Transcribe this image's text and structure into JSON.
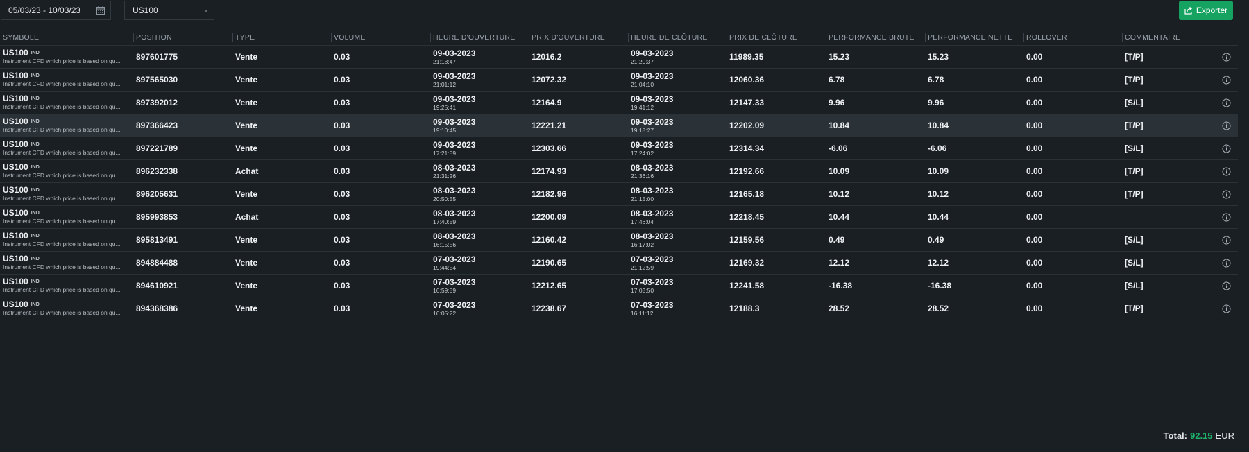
{
  "toolbar": {
    "date_range": "05/03/23 - 10/03/23",
    "symbol_filter": "US100",
    "export_label": "Exporter"
  },
  "columns": [
    "SYMBOLE",
    "POSITION",
    "TYPE",
    "VOLUME",
    "HEURE D'OUVERTURE",
    "PRIX D'OUVERTURE",
    "HEURE DE CLÔTURE",
    "PRIX DE CLÔTURE",
    "PERFORMANCE BRUTE",
    "PERFORMANCE NETTE",
    "ROLLOVER",
    "COMMENTAIRE"
  ],
  "rows": [
    {
      "symbol": "US100",
      "tag": "IND",
      "desc": "Instrument CFD which price is based on qu...",
      "position": "897601775",
      "type": "Vente",
      "volume": "0.03",
      "open_date": "09-03-2023",
      "open_time": "21:18:47",
      "open_price": "12016.2",
      "close_date": "09-03-2023",
      "close_time": "21:20:37",
      "close_price": "11989.35",
      "gross": "15.23",
      "net": "15.23",
      "net_sign": "pos",
      "rollover": "0.00",
      "comment": "[T/P]"
    },
    {
      "symbol": "US100",
      "tag": "IND",
      "desc": "Instrument CFD which price is based on qu...",
      "position": "897565030",
      "type": "Vente",
      "volume": "0.03",
      "open_date": "09-03-2023",
      "open_time": "21:01:12",
      "open_price": "12072.32",
      "close_date": "09-03-2023",
      "close_time": "21:04:10",
      "close_price": "12060.36",
      "gross": "6.78",
      "net": "6.78",
      "net_sign": "pos",
      "rollover": "0.00",
      "comment": "[T/P]"
    },
    {
      "symbol": "US100",
      "tag": "IND",
      "desc": "Instrument CFD which price is based on qu...",
      "position": "897392012",
      "type": "Vente",
      "volume": "0.03",
      "open_date": "09-03-2023",
      "open_time": "19:25:41",
      "open_price": "12164.9",
      "close_date": "09-03-2023",
      "close_time": "19:41:12",
      "close_price": "12147.33",
      "gross": "9.96",
      "net": "9.96",
      "net_sign": "pos",
      "rollover": "0.00",
      "comment": "[S/L]"
    },
    {
      "symbol": "US100",
      "tag": "IND",
      "desc": "Instrument CFD which price is based on qu...",
      "position": "897366423",
      "type": "Vente",
      "volume": "0.03",
      "open_date": "09-03-2023",
      "open_time": "19:10:45",
      "open_price": "12221.21",
      "close_date": "09-03-2023",
      "close_time": "19:18:27",
      "close_price": "12202.09",
      "gross": "10.84",
      "net": "10.84",
      "net_sign": "pos",
      "rollover": "0.00",
      "comment": "[T/P]",
      "highlight": true
    },
    {
      "symbol": "US100",
      "tag": "IND",
      "desc": "Instrument CFD which price is based on qu...",
      "position": "897221789",
      "type": "Vente",
      "volume": "0.03",
      "open_date": "09-03-2023",
      "open_time": "17:21:59",
      "open_price": "12303.66",
      "close_date": "09-03-2023",
      "close_time": "17:24:02",
      "close_price": "12314.34",
      "gross": "-6.06",
      "net": "-6.06",
      "net_sign": "neg",
      "rollover": "0.00",
      "comment": "[S/L]"
    },
    {
      "symbol": "US100",
      "tag": "IND",
      "desc": "Instrument CFD which price is based on qu...",
      "position": "896232338",
      "type": "Achat",
      "volume": "0.03",
      "open_date": "08-03-2023",
      "open_time": "21:31:26",
      "open_price": "12174.93",
      "close_date": "08-03-2023",
      "close_time": "21:36:16",
      "close_price": "12192.66",
      "gross": "10.09",
      "net": "10.09",
      "net_sign": "pos",
      "rollover": "0.00",
      "comment": "[T/P]"
    },
    {
      "symbol": "US100",
      "tag": "IND",
      "desc": "Instrument CFD which price is based on qu...",
      "position": "896205631",
      "type": "Vente",
      "volume": "0.03",
      "open_date": "08-03-2023",
      "open_time": "20:50:55",
      "open_price": "12182.96",
      "close_date": "08-03-2023",
      "close_time": "21:15:00",
      "close_price": "12165.18",
      "gross": "10.12",
      "net": "10.12",
      "net_sign": "pos",
      "rollover": "0.00",
      "comment": "[T/P]"
    },
    {
      "symbol": "US100",
      "tag": "IND",
      "desc": "Instrument CFD which price is based on qu...",
      "position": "895993853",
      "type": "Achat",
      "volume": "0.03",
      "open_date": "08-03-2023",
      "open_time": "17:40:59",
      "open_price": "12200.09",
      "close_date": "08-03-2023",
      "close_time": "17:46:04",
      "close_price": "12218.45",
      "gross": "10.44",
      "net": "10.44",
      "net_sign": "pos",
      "rollover": "0.00",
      "comment": ""
    },
    {
      "symbol": "US100",
      "tag": "IND",
      "desc": "Instrument CFD which price is based on qu...",
      "position": "895813491",
      "type": "Vente",
      "volume": "0.03",
      "open_date": "08-03-2023",
      "open_time": "16:15:56",
      "open_price": "12160.42",
      "close_date": "08-03-2023",
      "close_time": "16:17:02",
      "close_price": "12159.56",
      "gross": "0.49",
      "net": "0.49",
      "net_sign": "pos",
      "rollover": "0.00",
      "comment": "[S/L]"
    },
    {
      "symbol": "US100",
      "tag": "IND",
      "desc": "Instrument CFD which price is based on qu...",
      "position": "894884488",
      "type": "Vente",
      "volume": "0.03",
      "open_date": "07-03-2023",
      "open_time": "19:44:54",
      "open_price": "12190.65",
      "close_date": "07-03-2023",
      "close_time": "21:12:59",
      "close_price": "12169.32",
      "gross": "12.12",
      "net": "12.12",
      "net_sign": "pos",
      "rollover": "0.00",
      "comment": "[S/L]"
    },
    {
      "symbol": "US100",
      "tag": "IND",
      "desc": "Instrument CFD which price is based on qu...",
      "position": "894610921",
      "type": "Vente",
      "volume": "0.03",
      "open_date": "07-03-2023",
      "open_time": "16:59:59",
      "open_price": "12212.65",
      "close_date": "07-03-2023",
      "close_time": "17:03:50",
      "close_price": "12241.58",
      "gross": "-16.38",
      "net": "-16.38",
      "net_sign": "neg",
      "rollover": "0.00",
      "comment": "[S/L]"
    },
    {
      "symbol": "US100",
      "tag": "IND",
      "desc": "Instrument CFD which price is based on qu...",
      "position": "894368386",
      "type": "Vente",
      "volume": "0.03",
      "open_date": "07-03-2023",
      "open_time": "16:05:22",
      "open_price": "12238.67",
      "close_date": "07-03-2023",
      "close_time": "16:11:12",
      "close_price": "12188.3",
      "gross": "28.52",
      "net": "28.52",
      "net_sign": "pos",
      "rollover": "0.00",
      "comment": "[T/P]"
    }
  ],
  "total": {
    "label": "Total:",
    "value": "92.15",
    "currency": "EUR"
  },
  "colors": {
    "background": "#1a1f24",
    "accent_green": "#16a362",
    "positive": "#1fb56c",
    "negative": "#e0453d",
    "highlight_row": "#2a3137"
  },
  "icons": {
    "calendar": "calendar-icon",
    "export": "export-icon",
    "info": "info-icon",
    "dropdown": "chevron-down-icon"
  }
}
